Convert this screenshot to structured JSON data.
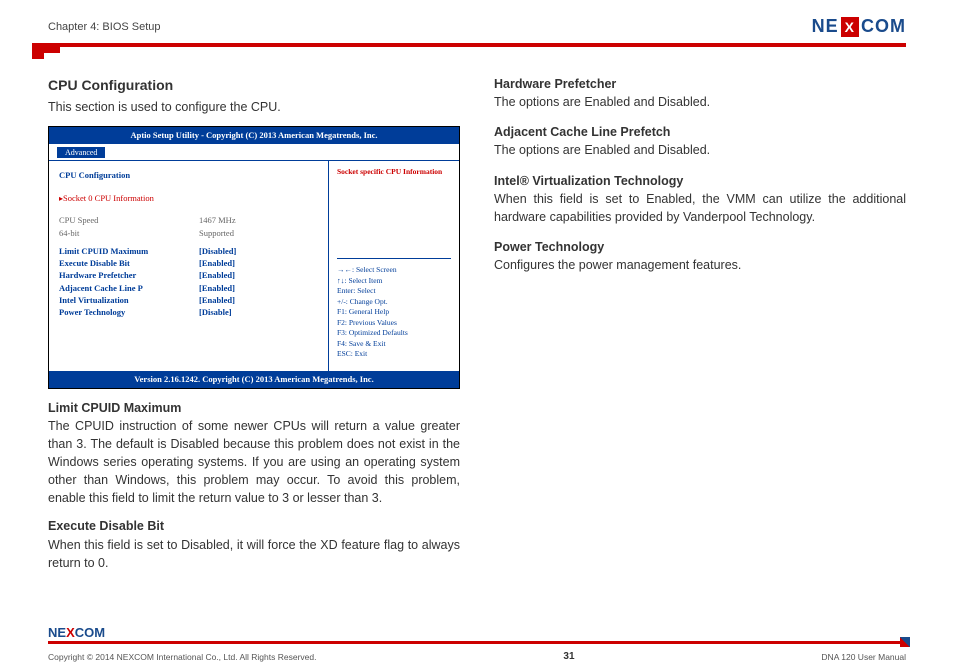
{
  "header": {
    "chapter": "Chapter 4: BIOS Setup",
    "logo": {
      "pre": "NE",
      "mid": "X",
      "post": "COM"
    }
  },
  "left": {
    "title": "CPU Configuration",
    "subtitle": "This section is used to configure the CPU.",
    "bios": {
      "top": "Aptio Setup Utility - Copyright (C) 2013 American Megatrends, Inc.",
      "tab": "Advanced",
      "mainHeader": "CPU Configuration",
      "selected": "Socket 0 CPU Information",
      "rows_gray": [
        {
          "l": "CPU Speed",
          "v": "1467 MHz"
        },
        {
          "l": "64-bit",
          "v": "Supported"
        }
      ],
      "rows_blue": [
        {
          "l": "Limit CPUID Maximum",
          "v": "[Disabled]"
        },
        {
          "l": "Execute Disable Bit",
          "v": "[Enabled]"
        },
        {
          "l": "Hardware Prefetcher",
          "v": "[Enabled]"
        },
        {
          "l": "Adjacent Cache Line P",
          "v": "[Enabled]"
        },
        {
          "l": "Intel Virtualization",
          "v": "[Enabled]"
        },
        {
          "l": "Power Technology",
          "v": "[Disable]"
        }
      ],
      "sideTitle": "Socket specific CPU Information",
      "help": [
        "→←: Select Screen",
        "↑↓: Select Item",
        "Enter: Select",
        "+/-: Change Opt.",
        "F1: General Help",
        "F2: Previous Values",
        "F3: Optimized Defaults",
        "F4: Save & Exit",
        "ESC: Exit"
      ],
      "footer": "Version 2.16.1242. Copyright (C) 2013 American Megatrends, Inc."
    },
    "sec1h": "Limit CPUID Maximum",
    "sec1p": "The CPUID instruction of some newer CPUs will return a value greater than 3. The default is Disabled because this problem does not exist in the Windows series operating systems. If you are using an operating system other than Windows, this problem may occur. To avoid this problem, enable this field to limit the return value to 3 or lesser than 3.",
    "sec2h": "Execute Disable Bit",
    "sec2p": "When this field is set to Disabled, it will force the XD feature flag to always return to 0."
  },
  "right": [
    {
      "h": "Hardware Prefetcher",
      "p": "The options are Enabled and Disabled."
    },
    {
      "h": "Adjacent Cache Line Prefetch",
      "p": "The options are Enabled and Disabled."
    },
    {
      "h": "Intel® Virtualization Technology",
      "p": "When this field is set to Enabled, the VMM can utilize the additional hardware capabilities provided by Vanderpool Technology."
    },
    {
      "h": "Power Technology",
      "p": "Configures the power management features."
    }
  ],
  "footer": {
    "copy": "Copyright © 2014 NEXCOM International Co., Ltd. All Rights Reserved.",
    "page": "31",
    "right": "DNA 120 User Manual"
  }
}
